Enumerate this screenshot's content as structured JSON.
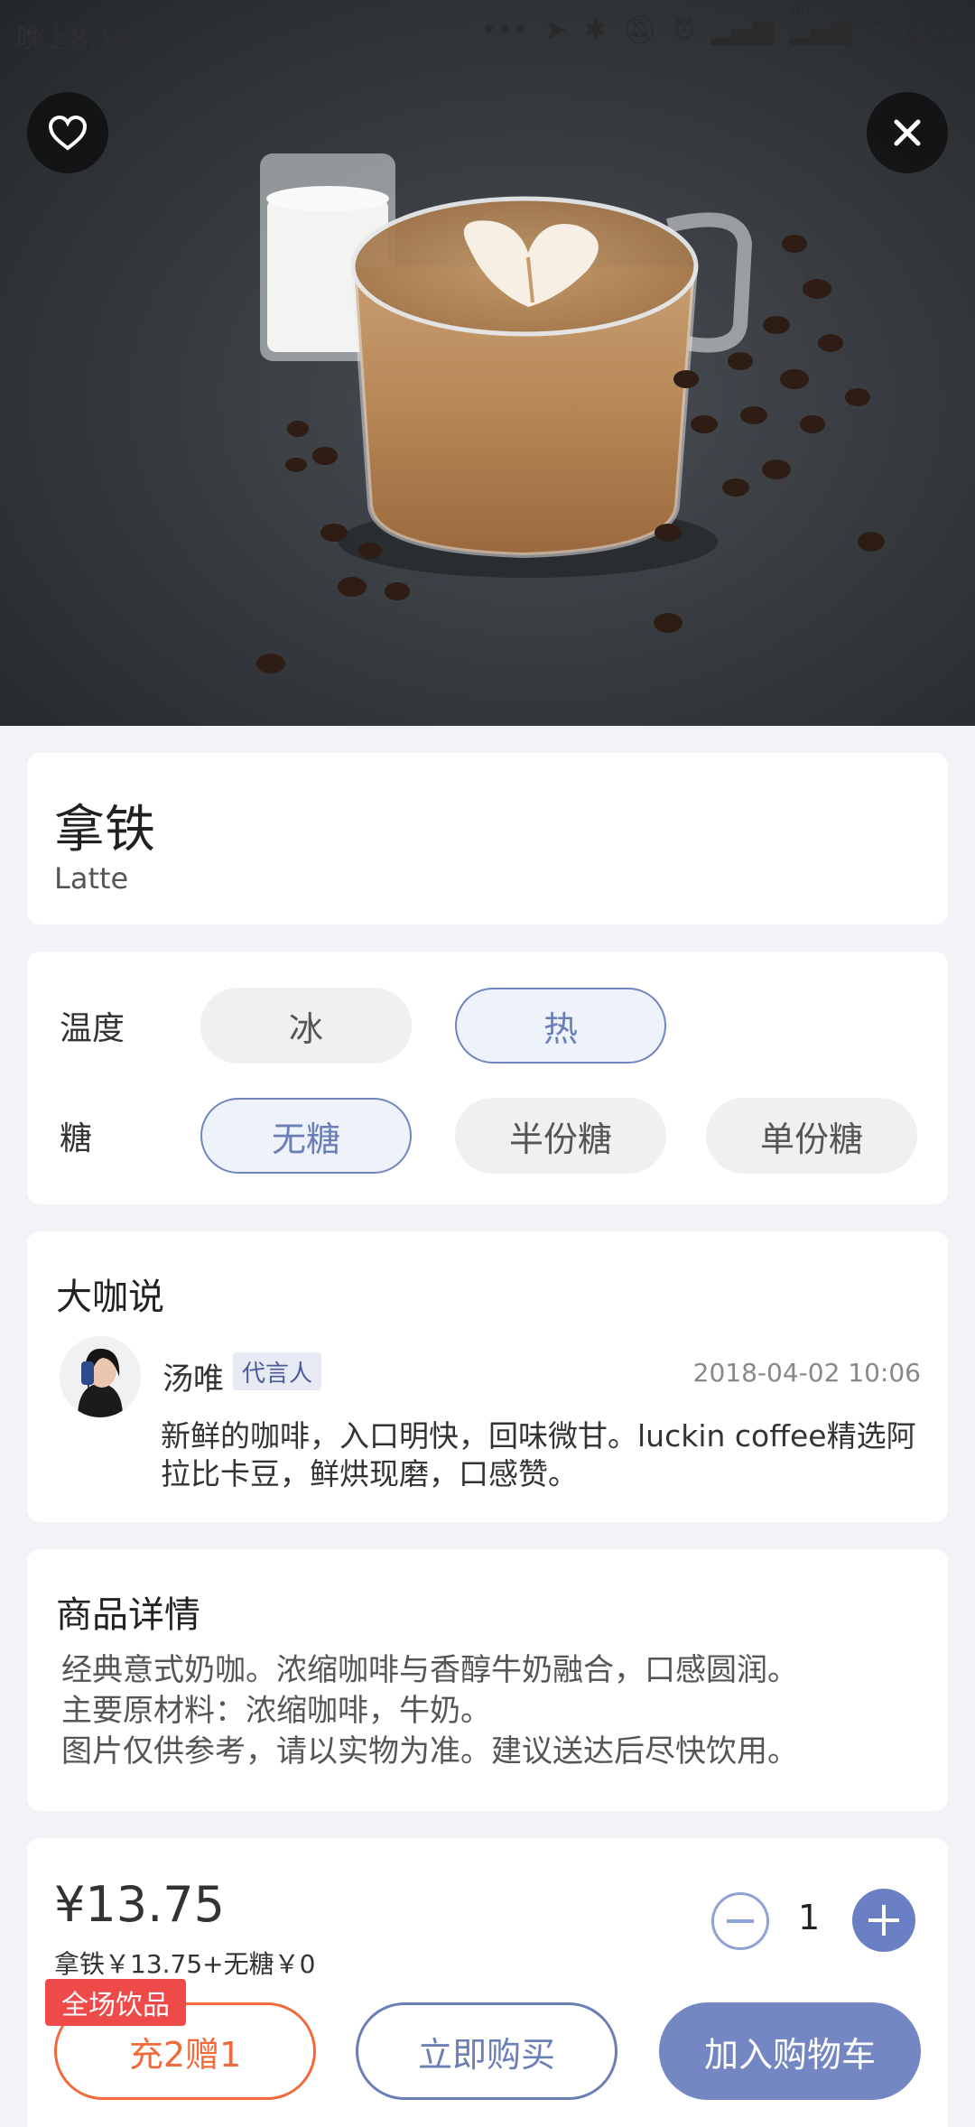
{
  "status_bar": {
    "time": "晚上8:14",
    "hd_label": "HD",
    "battery": "54"
  },
  "product": {
    "name_cn": "拿铁",
    "name_en": "Latte"
  },
  "options": {
    "temperature": {
      "label": "温度",
      "choices": [
        "冰",
        "热"
      ],
      "selected": "热"
    },
    "sugar": {
      "label": "糖",
      "choices": [
        "无糖",
        "半份糖",
        "单份糖"
      ],
      "selected": "无糖"
    }
  },
  "talk": {
    "title": "大咖说",
    "author": "汤唯",
    "tag": "代言人",
    "date": "2018-04-02 10:06",
    "quote": "新鲜的咖啡，入口明快，回味微甘。luckin coffee精选阿拉比卡豆，鲜烘现磨，口感赞。"
  },
  "details": {
    "title": "商品详情",
    "lines": [
      "经典意式奶咖。浓缩咖啡与香醇牛奶融合，口感圆润。",
      "主要原材料：浓缩咖啡，牛奶。",
      "图片仅供参考，请以实物为准。建议送达后尽快饮用。"
    ]
  },
  "purchase": {
    "price": "¥13.75",
    "breakdown": "拿铁￥13.75+无糖￥0",
    "quantity": "1",
    "promo_badge": "全场饮品",
    "promo_button": "充2赠1",
    "buy_now": "立即购买",
    "add_to_cart": "加入购物车"
  },
  "colors": {
    "accent": "#6b7fb6",
    "promo": "#f06a3b",
    "badge": "#ef4a4a"
  },
  "icons": {
    "favorite": "heart-icon",
    "close": "close-icon",
    "minus": "minus-icon",
    "plus": "plus-icon"
  }
}
